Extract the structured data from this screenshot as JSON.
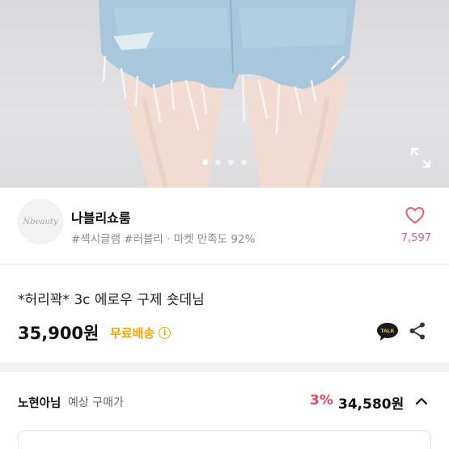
{
  "product_image": {
    "carousel_dots": [
      true,
      false,
      false,
      false
    ],
    "expand_icon": "expand-icon"
  },
  "seller": {
    "logo_text": "Nbeauty",
    "name": "나블리쇼룸",
    "tags": "#섹시글램 #러블리 · 마켓 만족도 92%",
    "like_icon": "heart-icon",
    "like_count": "7,597"
  },
  "product": {
    "title": "*허리꽉* 3c 에로우 구제 숏데님",
    "price": "35,900원",
    "shipping": "무료배송",
    "info_icon_glyph": "i",
    "talk_icon_text": "TALK",
    "share_icon": "share-icon"
  },
  "expected_price": {
    "member_name": "노현아님",
    "label": "예상 구매가",
    "discount": "3%",
    "final_price": "34,580원",
    "toggle_icon": "chevron-up-icon"
  },
  "colors": {
    "like": "#e4606d",
    "shipping": "#f0a500",
    "discount": "#e8485a"
  }
}
